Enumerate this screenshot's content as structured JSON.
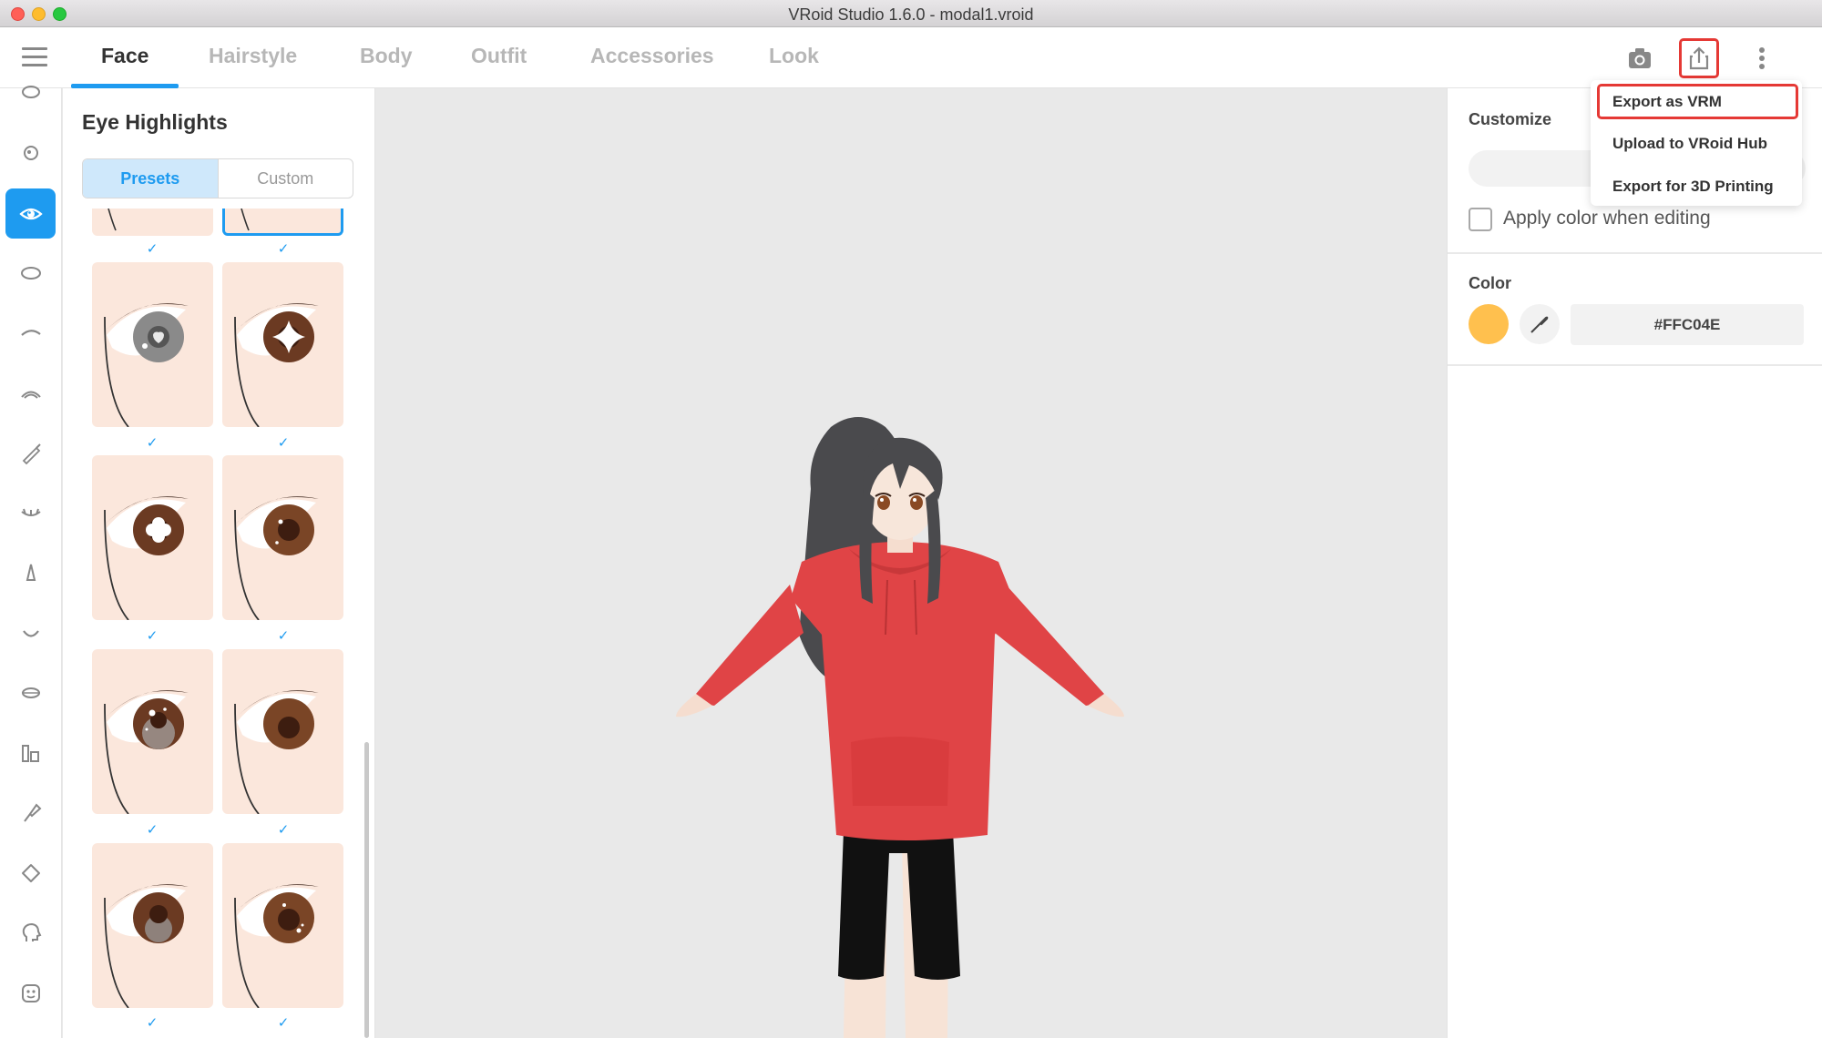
{
  "window": {
    "title": "VRoid Studio 1.6.0 - modal1.vroid"
  },
  "tabs": [
    {
      "label": "Face",
      "active": true
    },
    {
      "label": "Hairstyle",
      "active": false
    },
    {
      "label": "Body",
      "active": false
    },
    {
      "label": "Outfit",
      "active": false
    },
    {
      "label": "Accessories",
      "active": false
    },
    {
      "label": "Look",
      "active": false
    }
  ],
  "toolbar": {
    "icons": [
      "camera-icon",
      "export-icon",
      "more-vertical-icon"
    ]
  },
  "rail": {
    "items": [
      "face-outline-icon",
      "eye-ball-icon",
      "eye-highlight-icon",
      "eye-white-icon",
      "eyebrow-icon",
      "eyelash-upper-icon",
      "eyeliner-icon",
      "eyelash-lower-icon",
      "nose-icon",
      "mouth-icon",
      "lips-icon",
      "teeth-icon",
      "brush-icon",
      "ear-icon",
      "head-icon",
      "face-expression-icon"
    ],
    "active_index": 2
  },
  "panel": {
    "title": "Eye Highlights",
    "segments": [
      {
        "label": "Presets",
        "active": true
      },
      {
        "label": "Custom",
        "active": false
      }
    ],
    "check_glyph": "✓",
    "presets": [
      {
        "highlight": "heart-grey"
      },
      {
        "highlight": "star-white"
      },
      {
        "highlight": "cross-white"
      },
      {
        "highlight": "dot-small"
      },
      {
        "highlight": "sparkle-grey"
      },
      {
        "highlight": "none"
      },
      {
        "highlight": "soft-grey"
      },
      {
        "highlight": "dots-small"
      }
    ]
  },
  "right_panel": {
    "customize_label": "Customize",
    "apply_color_label": "Apply color when editing",
    "color_label": "Color",
    "color_hex": "#FFC04E",
    "swatch_color": "#FFC04E"
  },
  "export_menu": {
    "items": [
      {
        "label": "Export as VRM",
        "highlighted": true
      },
      {
        "label": "Upload to VRoid Hub",
        "highlighted": false
      },
      {
        "label": "Export for 3D Printing",
        "highlighted": false
      }
    ]
  },
  "colors": {
    "accent": "#1e9bf0",
    "highlight_outline": "#e53935",
    "hoodie": "#e04446",
    "skin": "#fbe7dc"
  }
}
